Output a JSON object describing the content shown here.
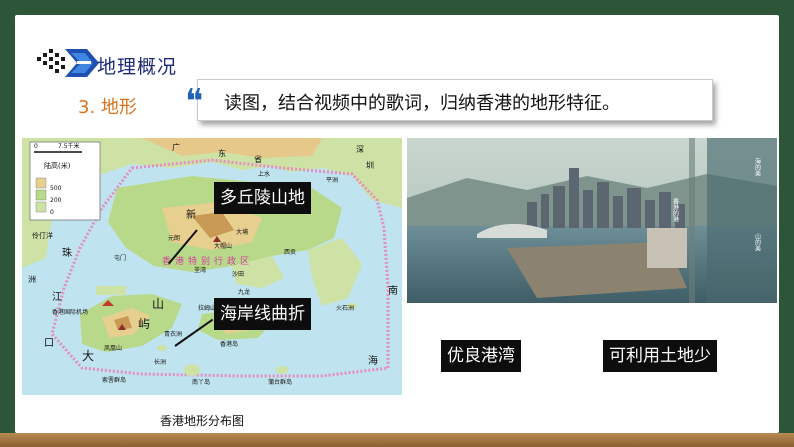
{
  "header": {
    "section_title": "地理概况",
    "subsection": "3. 地形",
    "quote_mark": "❝",
    "instruction": "读图，结合视频中的歌词，归纳香港的地形特征。"
  },
  "map": {
    "caption": "香港地形分布图",
    "scale_label": "7.5千米",
    "scale_zero": "0",
    "legend_title": "陆高(米)",
    "legend_values": [
      "500",
      "200",
      "0"
    ],
    "region_label": "香港特别行政区",
    "place_names": [
      "广",
      "东",
      "省",
      "深",
      "圳",
      "上水",
      "平洲",
      "新",
      "元朗",
      "大埔",
      "大帽山",
      "屯门",
      "荃湾",
      "沙田",
      "西贡",
      "九龙",
      "伶仃洋",
      "珠",
      "江",
      "口",
      "香港国际机场",
      "大",
      "屿",
      "山",
      "凤凰山",
      "拉姆山",
      "香港岛",
      "青衣洲",
      "长洲",
      "南丫岛",
      "索罟群岛",
      "蒲台群岛",
      "火石洲",
      "南",
      "海",
      "洲"
    ]
  },
  "labels": {
    "hills": "多丘陵山地",
    "coast": "海岸线曲折",
    "harbor": "优良港湾",
    "land": "可利用土地少"
  },
  "photo": {
    "subtitle_left": "香港的港",
    "subtitle_right_top": "海的美",
    "subtitle_right_bottom": "山的美"
  },
  "colors": {
    "title_blue": "#1d2a78",
    "subsection_orange": "#d9731f",
    "board_green": "#2c5637",
    "label_black": "#0d0d0d"
  }
}
